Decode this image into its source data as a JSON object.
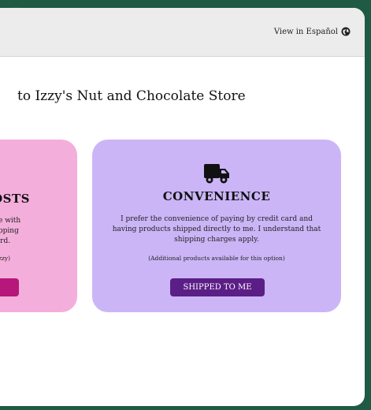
{
  "header": {
    "lang_link": "View in Español",
    "lang_icon": "globe-icon"
  },
  "welcome": {
    "text": "to Izzy's Nut and Chocolate Store"
  },
  "cards": {
    "costs": {
      "title": "OSTS",
      "text_line1": "nd coordinate with",
      "text_line2": "vill be no shipping",
      "text_line3": "y credit card.",
      "note": "zzy)",
      "color": "#f4aedb",
      "button_color": "#b5177a"
    },
    "convenience": {
      "icon": "truck-icon",
      "title": "CONVENIENCE",
      "text": "I prefer the convenience of paying by credit card and having products shipped directly to me. I understand that shipping charges apply.",
      "note": "(Additional products available for this option)",
      "button_label": "SHIPPED TO ME",
      "color": "#cbb5f7",
      "button_color": "#5b1e86"
    }
  },
  "colors": {
    "background": "#1f5a44",
    "header_bg": "#ececec"
  }
}
